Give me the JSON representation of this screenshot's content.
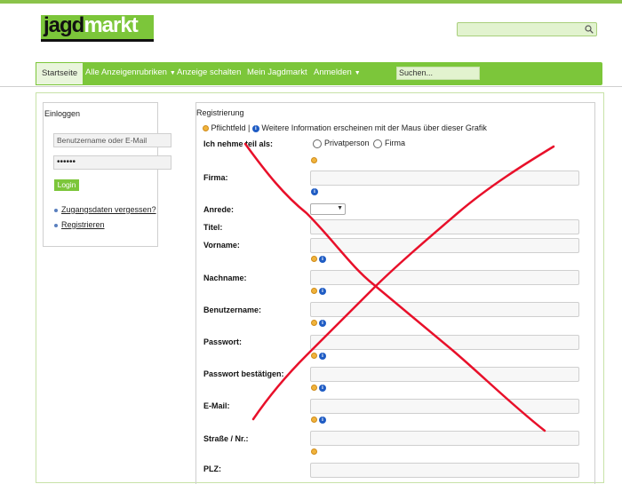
{
  "header": {
    "logo_text_dark": "jagd",
    "logo_text_light": "markt",
    "search_placeholder": ""
  },
  "nav": {
    "items": [
      {
        "label": "Startseite"
      },
      {
        "label": "Alle Anzeigenrubriken",
        "caret": "▼"
      },
      {
        "label": "Anzeige schalten"
      },
      {
        "label": "Mein Jagdmarkt"
      },
      {
        "label": "Anmelden",
        "caret": "▼"
      }
    ],
    "search_placeholder": "Suchen..."
  },
  "login": {
    "title": "Einloggen",
    "username_placeholder": "Benutzername oder E-Mail",
    "password_value": "••••••",
    "button": "Login",
    "links": [
      {
        "label": "Zugangsdaten vergessen?"
      },
      {
        "label": "Registrieren"
      }
    ]
  },
  "register": {
    "title": "Registrierung",
    "legend_required": "Pflichtfeld |",
    "legend_info": "Weitere Information erscheinen mit der Maus über dieser Grafik",
    "participate_label": "Ich nehme teil als:",
    "radio_options": [
      "Privatperson",
      "Firma"
    ],
    "fields": [
      {
        "label": "Firma:"
      },
      {
        "label": "Anrede:"
      },
      {
        "label": "Titel:"
      },
      {
        "label": "Vorname:"
      },
      {
        "label": "Nachname:"
      },
      {
        "label": "Benutzername:"
      },
      {
        "label": "Passwort:"
      },
      {
        "label": "Passwort bestätigen:"
      },
      {
        "label": "E-Mail:"
      },
      {
        "label": "Straße / Nr.:"
      },
      {
        "label": "PLZ:"
      }
    ]
  },
  "colors": {
    "brand_green": "#7cc63a",
    "annotation_red": "#e8102a"
  },
  "icons": [
    "search-icon",
    "required-bulb-icon",
    "info-icon",
    "chevron-down-icon"
  ]
}
